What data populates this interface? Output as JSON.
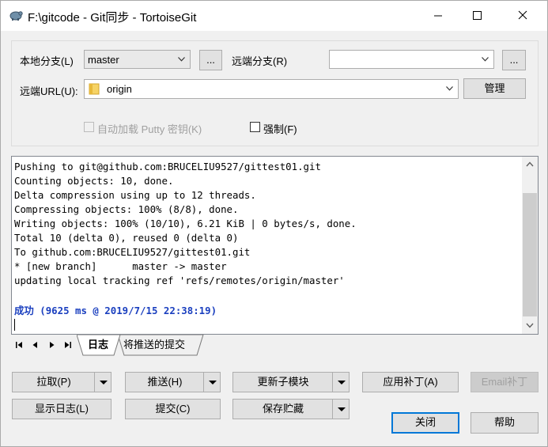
{
  "window": {
    "title": "F:\\gitcode - Git同步 - TortoiseGit"
  },
  "form": {
    "local_branch_label": "本地分支(L)",
    "local_branch_value": "master",
    "browse_label": "...",
    "remote_branch_label": "远端分支(R)",
    "remote_branch_value": "",
    "remote_url_label": "远端URL(U):",
    "remote_url_value": "origin",
    "manage_label": "管理",
    "autoload_putty_label": "自动加载 Putty 密钥(K)",
    "force_label": "强制(F)"
  },
  "log": {
    "lines": [
      "Pushing to git@github.com:BRUCELIU9527/gittest01.git",
      "Counting objects: 10, done.",
      "Delta compression using up to 12 threads.",
      "Compressing objects: 100% (8/8), done.",
      "Writing objects: 100% (10/10), 6.21 KiB | 0 bytes/s, done.",
      "Total 10 (delta 0), reused 0 (delta 0)",
      "To github.com:BRUCELIU9527/gittest01.git",
      "* [new branch]      master -> master",
      "updating local tracking ref 'refs/remotes/origin/master'"
    ],
    "success": "成功 (9625 ms @ 2019/7/15 22:38:19)"
  },
  "tabs": [
    {
      "label": "日志"
    },
    {
      "label": "将推送的提交"
    }
  ],
  "buttons": {
    "pull": "拉取(P)",
    "push": "推送(H)",
    "update_submodules": "更新子模块",
    "apply_patch": "应用补丁(A)",
    "email_patch": "Email补丁",
    "show_log": "显示日志(L)",
    "commit": "提交(C)",
    "stash": "保存贮藏",
    "close": "关闭",
    "help": "帮助"
  }
}
